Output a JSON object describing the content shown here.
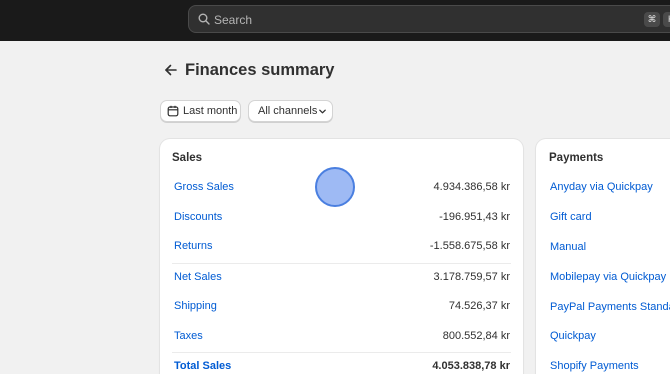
{
  "topbar": {
    "search_placeholder": "Search",
    "shortcut_keys": [
      "⌘",
      "K"
    ]
  },
  "page": {
    "title": "Finances summary",
    "back_icon": "arrow-left-icon"
  },
  "filters": {
    "date_label": "Last month",
    "date_icon": "calendar-icon",
    "channel_label": "All channels",
    "channel_icon": "chevron-down-icon"
  },
  "sales": {
    "title": "Sales",
    "rows": [
      {
        "label": "Gross Sales",
        "value": "4.934.386,58 kr"
      },
      {
        "label": "Discounts",
        "value": "-196.951,43 kr"
      },
      {
        "label": "Returns",
        "value": "-1.558.675,58 kr"
      },
      {
        "label": "Net Sales",
        "value": "3.178.759,57 kr"
      },
      {
        "label": "Shipping",
        "value": "74.526,37 kr"
      },
      {
        "label": "Taxes",
        "value": "800.552,84 kr"
      },
      {
        "label": "Total Sales",
        "value": "4.053.838,78 kr"
      }
    ]
  },
  "payments": {
    "title": "Payments",
    "items": [
      "Anyday via Quickpay",
      "Gift card",
      "Manual",
      "Mobilepay via Quickpay",
      "PayPal Payments Standard",
      "Quickpay",
      "Shopify Payments"
    ]
  },
  "colors": {
    "link": "#005bd3",
    "topbar": "#1a1a1a",
    "background": "#f1f1f1"
  }
}
